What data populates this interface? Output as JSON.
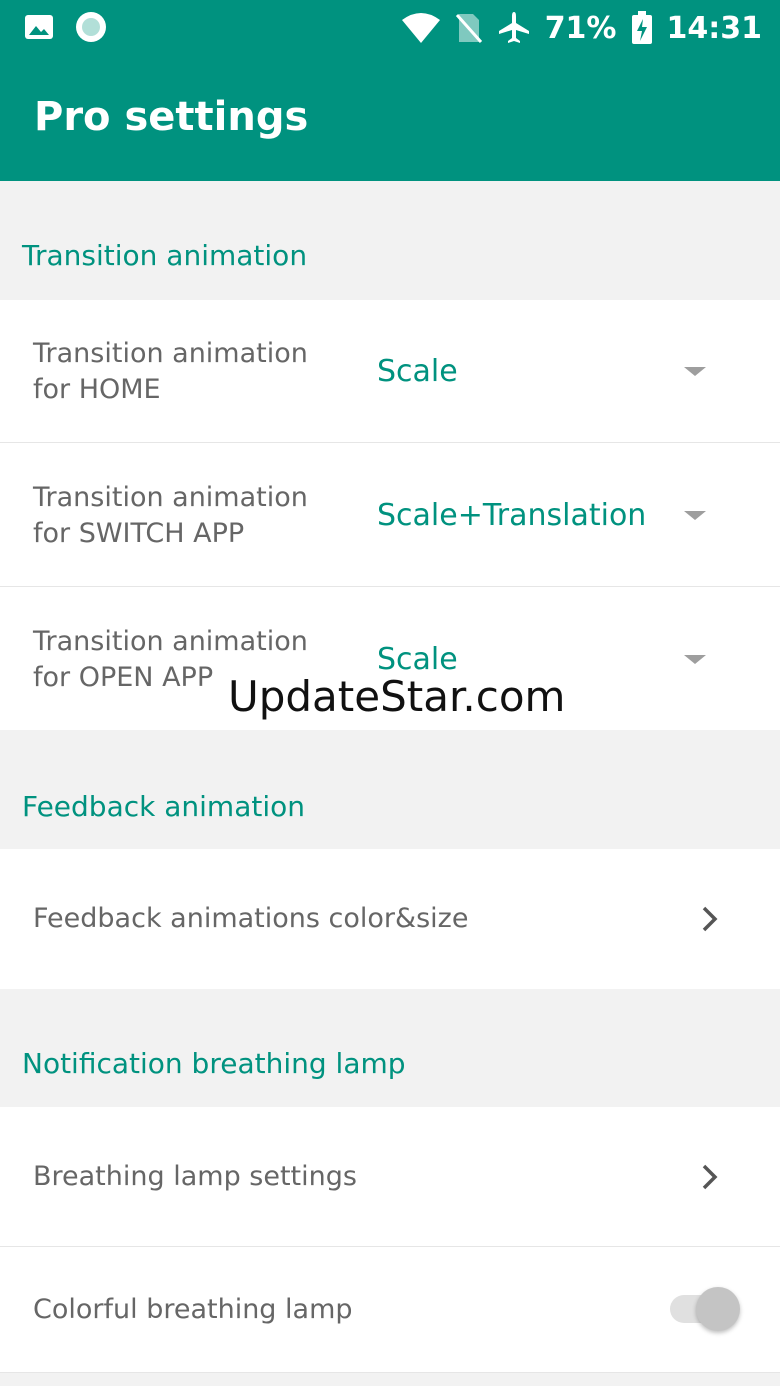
{
  "status_bar": {
    "icons_left": [
      "image-icon",
      "record-icon"
    ],
    "icons_right": [
      "wifi-icon",
      "no-sim-icon",
      "airplane-icon",
      "battery-charging-icon"
    ],
    "battery": "71%",
    "time": "14:31"
  },
  "app_bar": {
    "title": "Pro settings"
  },
  "sections": [
    {
      "header": "Transition animation",
      "items": [
        {
          "label": "Transition animation for HOME",
          "value": "Scale"
        },
        {
          "label": "Transition animation for SWITCH APP",
          "value": "Scale+Translation"
        },
        {
          "label": "Transition animation for OPEN APP",
          "value": "Scale"
        }
      ]
    },
    {
      "header": "Feedback animation",
      "items": [
        {
          "label": "Feedback animations color&size"
        }
      ]
    },
    {
      "header": "Notification breathing lamp",
      "items": [
        {
          "label": "Breathing lamp settings"
        },
        {
          "label": "Colorful breathing lamp",
          "toggle": false
        }
      ]
    }
  ],
  "watermark": "UpdateStar.com",
  "colors": {
    "accent": "#00927f",
    "background": "#f2f2f2",
    "row": "#ffffff",
    "label": "#666666"
  }
}
